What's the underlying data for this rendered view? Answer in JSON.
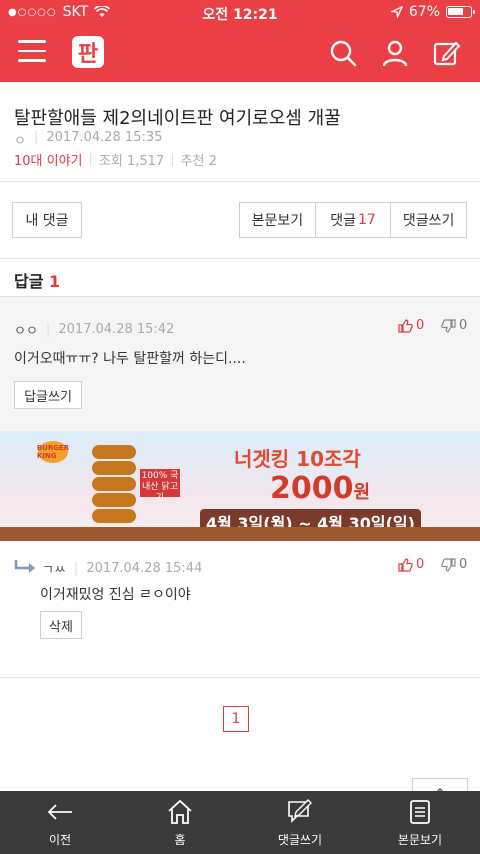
{
  "status_bar": {
    "carrier": "SKT",
    "time": "오전 12:21",
    "battery": "67%",
    "signal_dots": "●○○○○"
  },
  "app_bar": {
    "logo_text": "판"
  },
  "post": {
    "title": "탈판할애들 제2의네이트판 여기로오셈 개꿀",
    "author": "ㅇ",
    "date": "2017.04.28 15:35",
    "category": "10대 이야기",
    "views_label": "조회 1,517",
    "recommend_label": "추천 2"
  },
  "buttons": {
    "my_comments": "내 댓글",
    "view_body": "본문보기",
    "comments_label": "댓글",
    "comments_count": "17",
    "write_comment": "댓글쓰기"
  },
  "replies": {
    "label": "답글",
    "count": "1"
  },
  "comment": {
    "author": "ㅇㅇ",
    "date": "2017.04.28 15:42",
    "text": "이거오때ㅠㅠ? 나두 탈판할꺼 하는디....",
    "up": "0",
    "down": "0",
    "reply_button": "답글쓰기"
  },
  "ad": {
    "line1": "너겟킹 10조각",
    "line2": "2000",
    "line2_unit": "원",
    "line3": "4월 3일(월) ~ 4월 30일(일)",
    "ribbon": "100% 국내산 닭고기",
    "brand": "BURGER KING"
  },
  "reply": {
    "author": "ㄱㅆ",
    "date": "2017.04.28 15:44",
    "text": "이거재밌엉 진심 ㄹㅇ이야",
    "up": "0",
    "down": "0",
    "delete_button": "삭제"
  },
  "pagination": {
    "current": "1"
  },
  "bottom_nav": {
    "back": "이전",
    "home": "홈",
    "write": "댓글쓰기",
    "body": "본문보기"
  },
  "colors": {
    "brand_red": "#ea3f45",
    "bottom_bar": "#3a3a3a"
  }
}
